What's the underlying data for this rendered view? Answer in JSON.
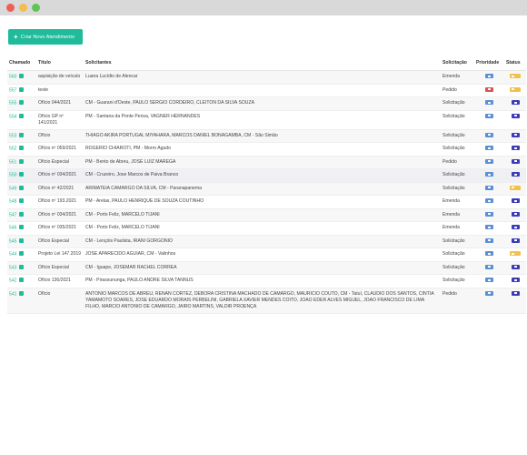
{
  "toolbar": {
    "new_label": "Criar Novo Atendimento"
  },
  "columns": [
    "Chamado",
    "Título",
    "Solicitantes",
    "Solicitação",
    "Prioridade",
    "Status"
  ],
  "colors": {
    "accent": "#1fbb9a",
    "priority_normal": "#5b8fd6",
    "priority_urgent": "#d9534f",
    "status_pending": "#f0c24b",
    "status_open": "#3b3bb8"
  },
  "rows": [
    {
      "id": "560",
      "title": "aquisição de veículo",
      "requesters": "Luana Lucídio de Alencar",
      "type": "Emenda",
      "priority": "normal",
      "status": "pending"
    },
    {
      "id": "557",
      "title": "teste",
      "requesters": "",
      "type": "Pedido",
      "priority": "urgent",
      "status": "pending"
    },
    {
      "id": "555",
      "title": "Ofício 044/2021",
      "requesters": "CM - Guarani d'Oeste, PAULO SERGIO CORDEIRO, CLEITON DA SILVA SOUZA",
      "type": "Solicitação",
      "priority": "normal",
      "status": "open"
    },
    {
      "id": "554",
      "title": "Ofício GP nº 141/2021",
      "requesters": "PM - Santana da Ponte Pensa, VAGNER HERNANDES",
      "type": "Solicitação",
      "priority": "normal",
      "status": "open"
    },
    {
      "id": "553",
      "title": "Ofício",
      "requesters": "THIAGO AKIRA PORTUGAL MIYAHARA, MARCOS DANIEL BONAGAMBA, CM - São Simão",
      "type": "Solicitação",
      "priority": "normal",
      "status": "open"
    },
    {
      "id": "552",
      "title": "Ofício nº 059/2021",
      "requesters": "ROGERIO CHIAROTI, PM - Morro Agudo",
      "type": "Solicitação",
      "priority": "normal",
      "status": "open"
    },
    {
      "id": "551",
      "title": "Ofício Especial",
      "requesters": "PM - Bento de Abreu, JOSE LUIZ MAREGA",
      "type": "Pedido",
      "priority": "normal",
      "status": "open"
    },
    {
      "id": "550",
      "title": "Ofício nº 034/2021",
      "requesters": "CM - Cruzeiro, Jose Marcos de Paiva Branco",
      "type": "Solicitação",
      "priority": "normal",
      "status": "open"
    },
    {
      "id": "549",
      "title": "Ofício nº 42/2021",
      "requesters": "ARIMATEIA CAMARGO DA SILVA, CM - Paranapanema",
      "type": "Solicitação",
      "priority": "normal",
      "status": "pending"
    },
    {
      "id": "548",
      "title": "Ofício nº 193.2021",
      "requesters": "PM - Arelas, PAULO HENRIQUE DE SOUZA COUTINHO",
      "type": "Emenda",
      "priority": "normal",
      "status": "open"
    },
    {
      "id": "547",
      "title": "Ofício nº 034/2021",
      "requesters": "CM - Porto Feliz, MARCELO TIJANI",
      "type": "Emenda",
      "priority": "normal",
      "status": "open"
    },
    {
      "id": "546",
      "title": "Ofício nº 035/2021",
      "requesters": "CM - Porto Feliz, MARCELO TIJANI",
      "type": "Emenda",
      "priority": "normal",
      "status": "open"
    },
    {
      "id": "545",
      "title": "Ofício Especial",
      "requesters": "CM - Lençóis Paulista, IRANI GORGONIO",
      "type": "Solicitação",
      "priority": "normal",
      "status": "open"
    },
    {
      "id": "544",
      "title": "Projeto Lei 147.2019",
      "requesters": "JOSE APARECIDO AGUIAR, CM - Valinhos",
      "type": "Solicitação",
      "priority": "normal",
      "status": "pending"
    },
    {
      "id": "543",
      "title": "Ofício Especial",
      "requesters": "CM - Iguape, JOSEMAR RACHEL CORREA",
      "type": "Solicitação",
      "priority": "normal",
      "status": "open"
    },
    {
      "id": "542",
      "title": "Ofício 136/2021",
      "requesters": "PM - Pirassununga, PAULO ANDRE SILVA TANNUS",
      "type": "Solicitação",
      "priority": "normal",
      "status": "open"
    },
    {
      "id": "541",
      "title": "Ofício",
      "requesters": "ANTONIO MARCOS DE ABREU, RENAN CORTEZ, DEBORA CRISTINA MACHADO DE CAMARGO, MAURICIO COUTO, CM - Tatuí, CLAUDIO DOS SANTOS, CINTIA YAMAMOTO SOARES, JOSE EDUARDO MORAIS PERBELINI, GABRIELA XAVIER MENDES COITO, JOAO EDER ALVES MIGUEL, JOAO FRANCISCO DE LIMA FILHO, MARCIO ANTONIO DE CAMARGO, JAIRO MARTINS, VALDIR PROENÇA",
      "type": "Pedido",
      "priority": "normal",
      "status": "open"
    }
  ]
}
